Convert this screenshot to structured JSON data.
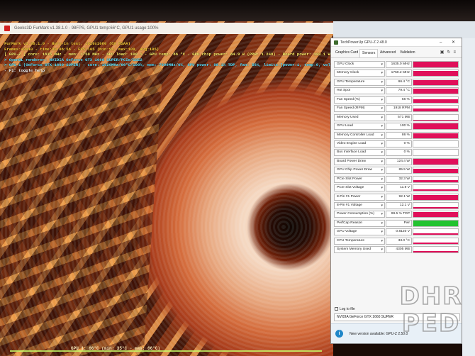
{
  "furmark": {
    "title": "Geeks3D FurMark v1.38.1.0 - 98FPS, GPU1 temp:66°C, GPU1 usage:100%",
    "osd": {
      "line1": "FurMark v1.38.1.0 - Burn-in test, 1920x1080 (8X MSAA)",
      "line2": "Frames:43010 - time:00:06:56 - FPS:105 (min:91, max:109, avg:105)",
      "line3": "[ GPU-Z ] core: 1635 MHz - mem: 1750 MHz - GPU load: 100 % - GPU temp: 66 °C - GPU chip power: 84.9 W (PPW: 1.248) - Board power: 123.1 W (PPW: 0.853) - GPU voltage: 0.812 V",
      "line4": "> OpenGL renderer: NVIDIA GeForce GTX 1660 SUPER/PCIe/SSE2",
      "line5": "> GPU 1 (GeForce GTX 1660 SUPER) - core: 1620MHz/66°C/100%, mem: 7000MHz/6%, GPU power: 98.1% TDP, fan: 56%, limits:[power:1, temp:0, volt:0, OV:0]",
      "line6": "- F1: toggle help"
    },
    "bottom_text": "GPU 1: 66°C (min: 35°C - max: 66°C)"
  },
  "gpuz": {
    "title": "TechPowerUp GPU-Z 2.48.0",
    "window_controls": "–  ✕",
    "tabs": [
      "Graphics Card",
      "Sensors",
      "Advanced",
      "Validation"
    ],
    "active_tab": "Sensors",
    "tools_icons": [
      "camera-icon",
      "refresh-icon",
      "menu-icon"
    ],
    "sensors": [
      {
        "name": "GPU Clock",
        "value": "1635.0 MHz",
        "fill": 0.98,
        "color": "#e0105a"
      },
      {
        "name": "Memory Clock",
        "value": "1750.2 MHz",
        "fill": 0.98,
        "color": "#e0105a"
      },
      {
        "name": "GPU Temperature",
        "value": "66.4 °C",
        "fill": 0.9,
        "color": "#e0105a"
      },
      {
        "name": "Hot Spot",
        "value": "79.4 °C",
        "fill": 0.9,
        "color": "#e0105a"
      },
      {
        "name": "Fan Speed (%)",
        "value": "56 %",
        "fill": 0.55,
        "color": "#e0105a"
      },
      {
        "name": "Fan Speed (RPM)",
        "value": "1918 RPM",
        "fill": 0.5,
        "color": "#e0105a"
      },
      {
        "name": "Memory Used",
        "value": "571 MB",
        "fill": 0.12,
        "color": "#e0105a"
      },
      {
        "name": "GPU Load",
        "value": "100 %",
        "fill": 0.98,
        "color": "#e0105a"
      },
      {
        "name": "Memory Controller Load",
        "value": "86 %",
        "fill": 0.86,
        "color": "#e0105a"
      },
      {
        "name": "Video Engine Load",
        "value": "0 %",
        "fill": 0.0,
        "color": "#e0105a"
      },
      {
        "name": "Bus Interface Load",
        "value": "0 %",
        "fill": 0.05,
        "color": "#e0105a"
      },
      {
        "name": "Board Power Draw",
        "value": "124.4 W",
        "fill": 0.92,
        "color": "#e0105a"
      },
      {
        "name": "GPU Chip Power Draw",
        "value": "85.5 W",
        "fill": 0.75,
        "color": "#e0105a"
      },
      {
        "name": "PCIe Slot Power",
        "value": "32.3 W",
        "fill": 0.4,
        "color": "#e0105a"
      },
      {
        "name": "PCIe Slot Voltage",
        "value": "11.9 V",
        "fill": 0.3,
        "color": "#e0105a"
      },
      {
        "name": "8-Pin #1 Power",
        "value": "92.1 W",
        "fill": 0.8,
        "color": "#e0105a"
      },
      {
        "name": "8-Pin #1 Voltage",
        "value": "12.1 V",
        "fill": 0.3,
        "color": "#e0105a"
      },
      {
        "name": "Power Consumption (%)",
        "value": "99.5 % TDP",
        "fill": 0.96,
        "color": "#e0105a"
      },
      {
        "name": "PerfCap Reason",
        "value": "Pwr",
        "fill": 1.0,
        "color": "#22c32f"
      },
      {
        "name": "GPU Voltage",
        "value": "0.8120 V",
        "fill": 0.25,
        "color": "#e0105a"
      },
      {
        "name": "CPU Temperature",
        "value": "33.0 °C",
        "fill": 0.2,
        "color": "#e0105a"
      },
      {
        "name": "System Memory Used",
        "value": "4305 MB",
        "fill": 0.3,
        "color": "#e0105a"
      }
    ],
    "log_label": "Log to file",
    "gpu_selected": "NVIDIA GeForce GTX 1660 SUPER",
    "notice": "New version available: GPU-Z 2.50.0"
  },
  "watermark": {
    "line1": "DHR",
    "line2": "PED"
  }
}
